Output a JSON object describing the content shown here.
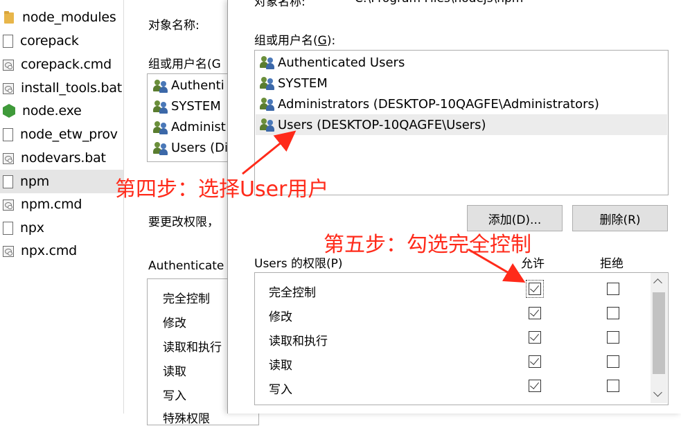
{
  "explorer": {
    "files": [
      {
        "name": "node_modules",
        "icon": "folder-icon"
      },
      {
        "name": "corepack",
        "icon": "file-icon"
      },
      {
        "name": "corepack.cmd",
        "icon": "script-icon"
      },
      {
        "name": "install_tools.bat",
        "icon": "script-icon"
      },
      {
        "name": "node.exe",
        "icon": "node-icon"
      },
      {
        "name": "node_etw_prov",
        "icon": "file-icon"
      },
      {
        "name": "nodevars.bat",
        "icon": "script-icon"
      },
      {
        "name": "npm",
        "icon": "file-icon"
      },
      {
        "name": "npm.cmd",
        "icon": "script-icon"
      },
      {
        "name": "npx",
        "icon": "file-icon"
      },
      {
        "name": "npx.cmd",
        "icon": "script-icon"
      }
    ],
    "selected_index": 7
  },
  "back_dialog": {
    "object_name_label": "对象名称:",
    "groups_label": "组或用户名(G",
    "users": [
      "Authenti",
      "SYSTEM",
      "Administ",
      "Users (Di"
    ],
    "change_perm_text": "要更改权限，",
    "perm_header": "Authenticate",
    "perms": [
      "完全控制",
      "修改",
      "读取和执行",
      "读取",
      "写入",
      "特殊权限"
    ]
  },
  "front_dialog": {
    "object_name_label": "对象名称:",
    "object_path": "C:\\Program Files\\nodejs\\npm",
    "groups_label": "组或用户名(",
    "groups_label_key": "G",
    "groups_label_end": "):",
    "users": [
      "Authenticated Users",
      "SYSTEM",
      "Administrators (DESKTOP-10QAGFE\\Administrators)",
      "Users (DESKTOP-10QAGFE\\Users)"
    ],
    "selected_user_index": 3,
    "add_button": "添加(D)...",
    "remove_button": "删除(R)",
    "perm_label": "Users 的权限(P)",
    "allow_header": "允许",
    "deny_header": "拒绝",
    "permissions": [
      {
        "name": "完全控制",
        "allow": true,
        "deny": false
      },
      {
        "name": "修改",
        "allow": true,
        "deny": false
      },
      {
        "name": "读取和执行",
        "allow": true,
        "deny": false
      },
      {
        "name": "读取",
        "allow": true,
        "deny": false
      },
      {
        "name": "写入",
        "allow": true,
        "deny": false
      }
    ]
  },
  "annotations": {
    "step4": "第四步：选择User用户",
    "step5": "第五步：勾选完全控制",
    "color": "#ff2a1a"
  }
}
